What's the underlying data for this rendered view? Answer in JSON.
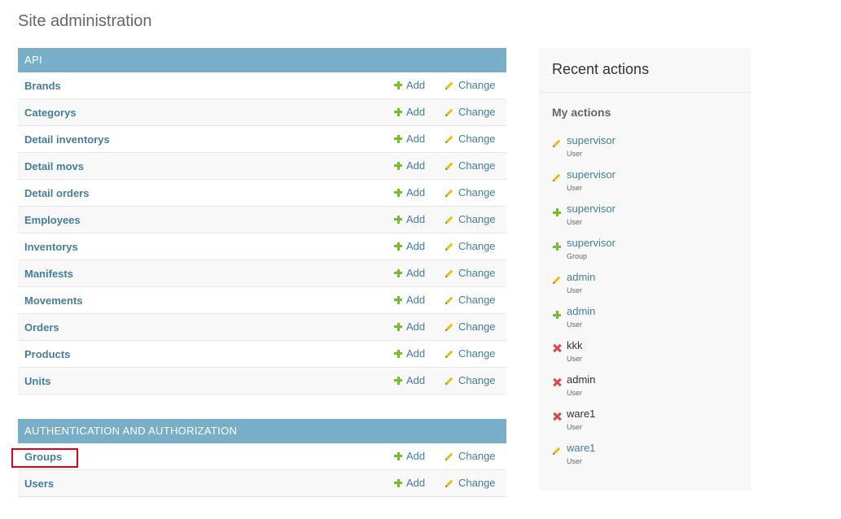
{
  "page": {
    "title": "Site administration"
  },
  "modules": [
    {
      "caption": "API",
      "add_label": "Add",
      "change_label": "Change",
      "models": [
        "Brands",
        "Categorys",
        "Detail inventorys",
        "Detail movs",
        "Detail orders",
        "Employees",
        "Inventorys",
        "Manifests",
        "Movements",
        "Orders",
        "Products",
        "Units"
      ]
    },
    {
      "caption": "AUTHENTICATION AND AUTHORIZATION",
      "add_label": "Add",
      "change_label": "Change",
      "models": [
        "Groups",
        "Users"
      ]
    }
  ],
  "recent": {
    "title": "Recent actions",
    "subtitle": "My actions",
    "actions": [
      {
        "icon": "pencil-icon",
        "object": "supervisor",
        "type": "User"
      },
      {
        "icon": "pencil-icon",
        "object": "supervisor",
        "type": "User"
      },
      {
        "icon": "plus-icon",
        "object": "supervisor",
        "type": "User"
      },
      {
        "icon": "plus-icon",
        "object": "supervisor",
        "type": "Group"
      },
      {
        "icon": "pencil-icon",
        "object": "admin",
        "type": "User"
      },
      {
        "icon": "plus-icon",
        "object": "admin",
        "type": "User"
      },
      {
        "icon": "delete-icon",
        "object": "kkk",
        "type": "User"
      },
      {
        "icon": "delete-icon",
        "object": "admin",
        "type": "User"
      },
      {
        "icon": "delete-icon",
        "object": "ware1",
        "type": "User"
      },
      {
        "icon": "pencil-icon",
        "object": "ware1",
        "type": "User"
      }
    ]
  },
  "colors": {
    "header": "#79aec8",
    "link": "#447e9b",
    "add": "#70bf2b",
    "change": "#efb80b",
    "delete": "#dd4646",
    "highlight": "#e0001a"
  }
}
